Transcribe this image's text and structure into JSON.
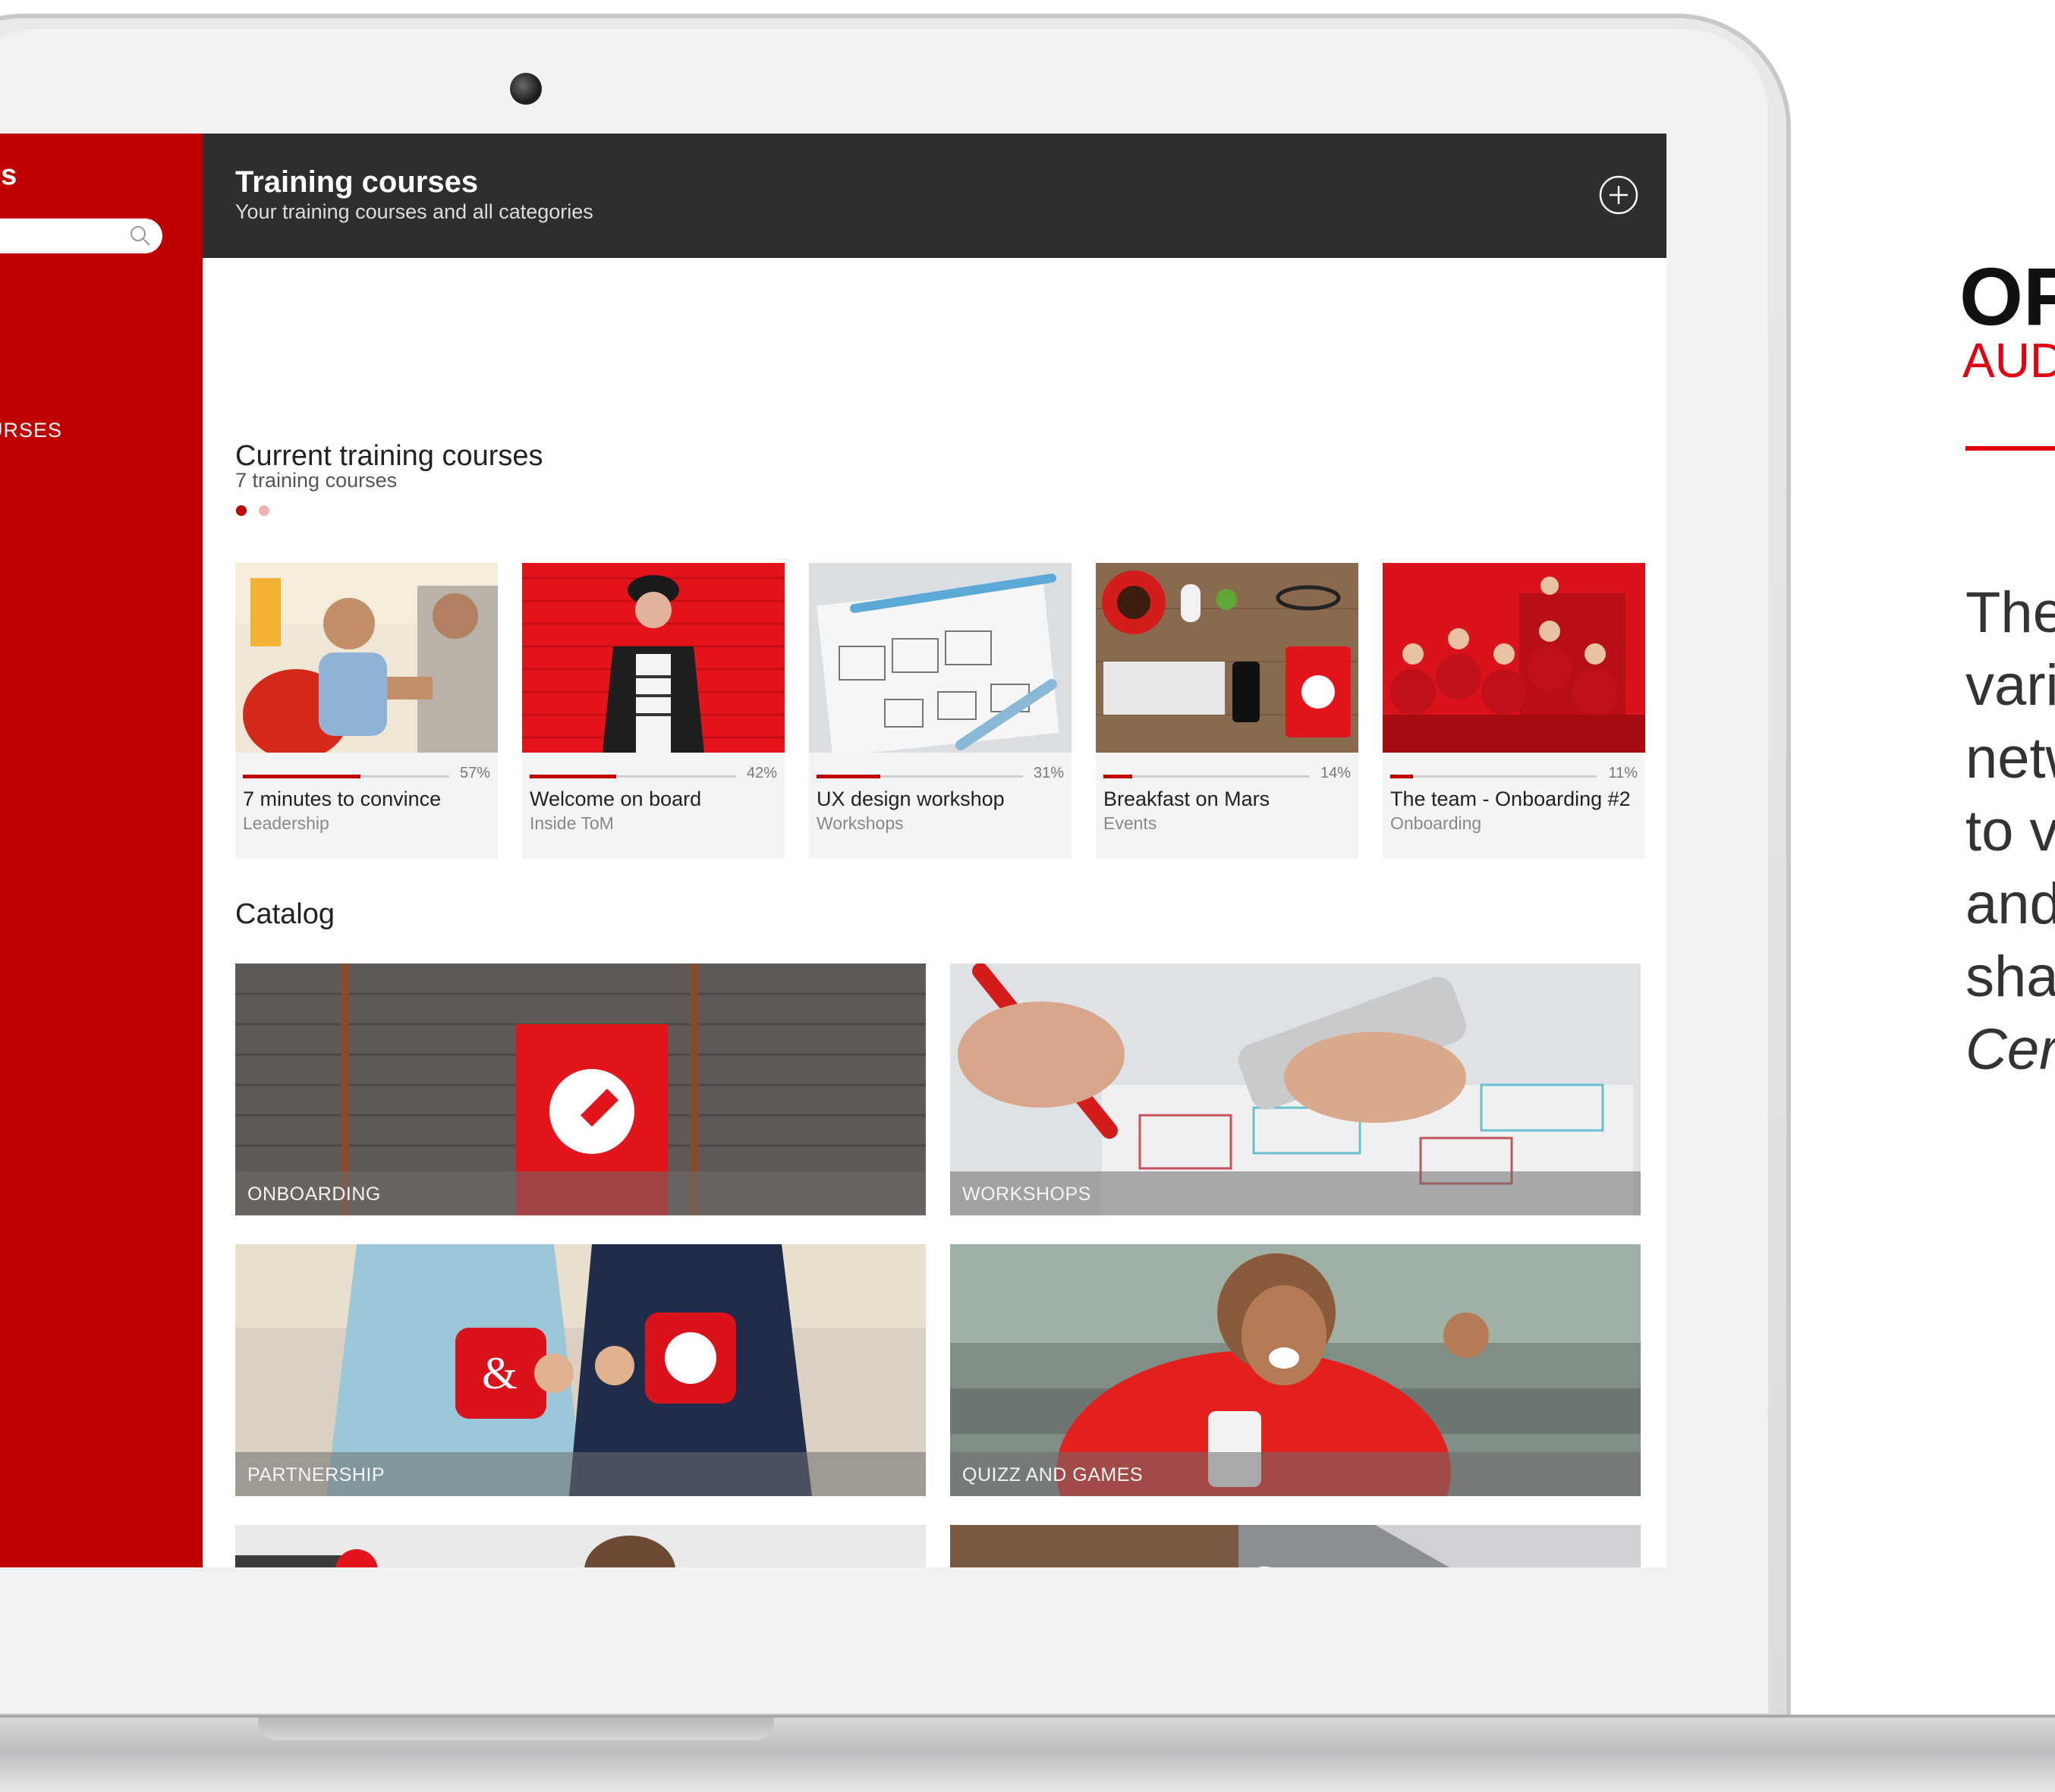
{
  "sidebar": {
    "title": "es",
    "search": {
      "placeholder": ""
    },
    "menu_item": "URSES"
  },
  "header": {
    "title": "Training courses",
    "subtitle": "Your training courses and all categories"
  },
  "current": {
    "title": "Current training courses",
    "count": "7 training courses",
    "courses": [
      {
        "name": "7 minutes to convince",
        "category": "Leadership",
        "progress_label": "57%",
        "progress": 0.57
      },
      {
        "name": "Welcome on board",
        "category": "Inside ToM",
        "progress_label": "42%",
        "progress": 0.42
      },
      {
        "name": "UX design workshop",
        "category": "Workshops",
        "progress_label": "31%",
        "progress": 0.31
      },
      {
        "name": "Breakfast on Mars",
        "category": "Events",
        "progress_label": "14%",
        "progress": 0.14
      },
      {
        "name": "The team - Onboarding #2",
        "category": "Onboarding",
        "progress_label": "11%",
        "progress": 0.11
      }
    ]
  },
  "catalog": {
    "title": "Catalog",
    "tiles": [
      {
        "label": "ONBOARDING"
      },
      {
        "label": "WORKSHOPS"
      },
      {
        "label": "PARTNERSHIP"
      },
      {
        "label": "QUIZZ AND GAMES"
      },
      {
        "label": ""
      },
      {
        "label": ""
      }
    ]
  },
  "promo": {
    "heading": "OF",
    "subheading": "AUD",
    "body_lines": [
      "The",
      "vari",
      "netw",
      "to v",
      "and",
      "sha"
    ],
    "body_italic": "Cer"
  },
  "colors": {
    "accent": "#c00000",
    "topbar": "#2e2e2e",
    "promo_red": "#e3000f"
  }
}
